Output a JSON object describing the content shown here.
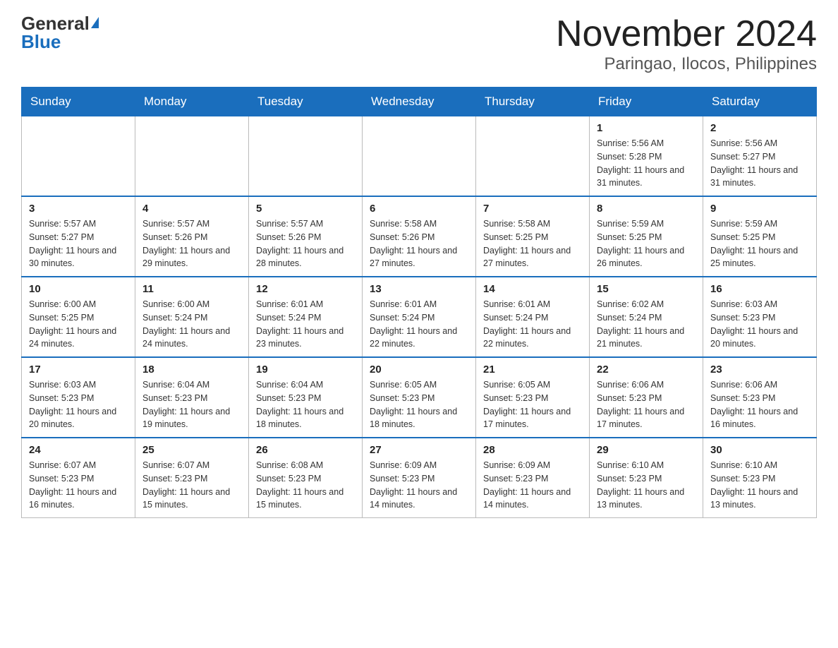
{
  "header": {
    "logo_general": "General",
    "logo_blue": "Blue",
    "title": "November 2024",
    "subtitle": "Paringao, Ilocos, Philippines"
  },
  "weekdays": [
    "Sunday",
    "Monday",
    "Tuesday",
    "Wednesday",
    "Thursday",
    "Friday",
    "Saturday"
  ],
  "weeks": [
    [
      {
        "day": "",
        "sunrise": "",
        "sunset": "",
        "daylight": ""
      },
      {
        "day": "",
        "sunrise": "",
        "sunset": "",
        "daylight": ""
      },
      {
        "day": "",
        "sunrise": "",
        "sunset": "",
        "daylight": ""
      },
      {
        "day": "",
        "sunrise": "",
        "sunset": "",
        "daylight": ""
      },
      {
        "day": "",
        "sunrise": "",
        "sunset": "",
        "daylight": ""
      },
      {
        "day": "1",
        "sunrise": "Sunrise: 5:56 AM",
        "sunset": "Sunset: 5:28 PM",
        "daylight": "Daylight: 11 hours and 31 minutes."
      },
      {
        "day": "2",
        "sunrise": "Sunrise: 5:56 AM",
        "sunset": "Sunset: 5:27 PM",
        "daylight": "Daylight: 11 hours and 31 minutes."
      }
    ],
    [
      {
        "day": "3",
        "sunrise": "Sunrise: 5:57 AM",
        "sunset": "Sunset: 5:27 PM",
        "daylight": "Daylight: 11 hours and 30 minutes."
      },
      {
        "day": "4",
        "sunrise": "Sunrise: 5:57 AM",
        "sunset": "Sunset: 5:26 PM",
        "daylight": "Daylight: 11 hours and 29 minutes."
      },
      {
        "day": "5",
        "sunrise": "Sunrise: 5:57 AM",
        "sunset": "Sunset: 5:26 PM",
        "daylight": "Daylight: 11 hours and 28 minutes."
      },
      {
        "day": "6",
        "sunrise": "Sunrise: 5:58 AM",
        "sunset": "Sunset: 5:26 PM",
        "daylight": "Daylight: 11 hours and 27 minutes."
      },
      {
        "day": "7",
        "sunrise": "Sunrise: 5:58 AM",
        "sunset": "Sunset: 5:25 PM",
        "daylight": "Daylight: 11 hours and 27 minutes."
      },
      {
        "day": "8",
        "sunrise": "Sunrise: 5:59 AM",
        "sunset": "Sunset: 5:25 PM",
        "daylight": "Daylight: 11 hours and 26 minutes."
      },
      {
        "day": "9",
        "sunrise": "Sunrise: 5:59 AM",
        "sunset": "Sunset: 5:25 PM",
        "daylight": "Daylight: 11 hours and 25 minutes."
      }
    ],
    [
      {
        "day": "10",
        "sunrise": "Sunrise: 6:00 AM",
        "sunset": "Sunset: 5:25 PM",
        "daylight": "Daylight: 11 hours and 24 minutes."
      },
      {
        "day": "11",
        "sunrise": "Sunrise: 6:00 AM",
        "sunset": "Sunset: 5:24 PM",
        "daylight": "Daylight: 11 hours and 24 minutes."
      },
      {
        "day": "12",
        "sunrise": "Sunrise: 6:01 AM",
        "sunset": "Sunset: 5:24 PM",
        "daylight": "Daylight: 11 hours and 23 minutes."
      },
      {
        "day": "13",
        "sunrise": "Sunrise: 6:01 AM",
        "sunset": "Sunset: 5:24 PM",
        "daylight": "Daylight: 11 hours and 22 minutes."
      },
      {
        "day": "14",
        "sunrise": "Sunrise: 6:01 AM",
        "sunset": "Sunset: 5:24 PM",
        "daylight": "Daylight: 11 hours and 22 minutes."
      },
      {
        "day": "15",
        "sunrise": "Sunrise: 6:02 AM",
        "sunset": "Sunset: 5:24 PM",
        "daylight": "Daylight: 11 hours and 21 minutes."
      },
      {
        "day": "16",
        "sunrise": "Sunrise: 6:03 AM",
        "sunset": "Sunset: 5:23 PM",
        "daylight": "Daylight: 11 hours and 20 minutes."
      }
    ],
    [
      {
        "day": "17",
        "sunrise": "Sunrise: 6:03 AM",
        "sunset": "Sunset: 5:23 PM",
        "daylight": "Daylight: 11 hours and 20 minutes."
      },
      {
        "day": "18",
        "sunrise": "Sunrise: 6:04 AM",
        "sunset": "Sunset: 5:23 PM",
        "daylight": "Daylight: 11 hours and 19 minutes."
      },
      {
        "day": "19",
        "sunrise": "Sunrise: 6:04 AM",
        "sunset": "Sunset: 5:23 PM",
        "daylight": "Daylight: 11 hours and 18 minutes."
      },
      {
        "day": "20",
        "sunrise": "Sunrise: 6:05 AM",
        "sunset": "Sunset: 5:23 PM",
        "daylight": "Daylight: 11 hours and 18 minutes."
      },
      {
        "day": "21",
        "sunrise": "Sunrise: 6:05 AM",
        "sunset": "Sunset: 5:23 PM",
        "daylight": "Daylight: 11 hours and 17 minutes."
      },
      {
        "day": "22",
        "sunrise": "Sunrise: 6:06 AM",
        "sunset": "Sunset: 5:23 PM",
        "daylight": "Daylight: 11 hours and 17 minutes."
      },
      {
        "day": "23",
        "sunrise": "Sunrise: 6:06 AM",
        "sunset": "Sunset: 5:23 PM",
        "daylight": "Daylight: 11 hours and 16 minutes."
      }
    ],
    [
      {
        "day": "24",
        "sunrise": "Sunrise: 6:07 AM",
        "sunset": "Sunset: 5:23 PM",
        "daylight": "Daylight: 11 hours and 16 minutes."
      },
      {
        "day": "25",
        "sunrise": "Sunrise: 6:07 AM",
        "sunset": "Sunset: 5:23 PM",
        "daylight": "Daylight: 11 hours and 15 minutes."
      },
      {
        "day": "26",
        "sunrise": "Sunrise: 6:08 AM",
        "sunset": "Sunset: 5:23 PM",
        "daylight": "Daylight: 11 hours and 15 minutes."
      },
      {
        "day": "27",
        "sunrise": "Sunrise: 6:09 AM",
        "sunset": "Sunset: 5:23 PM",
        "daylight": "Daylight: 11 hours and 14 minutes."
      },
      {
        "day": "28",
        "sunrise": "Sunrise: 6:09 AM",
        "sunset": "Sunset: 5:23 PM",
        "daylight": "Daylight: 11 hours and 14 minutes."
      },
      {
        "day": "29",
        "sunrise": "Sunrise: 6:10 AM",
        "sunset": "Sunset: 5:23 PM",
        "daylight": "Daylight: 11 hours and 13 minutes."
      },
      {
        "day": "30",
        "sunrise": "Sunrise: 6:10 AM",
        "sunset": "Sunset: 5:23 PM",
        "daylight": "Daylight: 11 hours and 13 minutes."
      }
    ]
  ]
}
